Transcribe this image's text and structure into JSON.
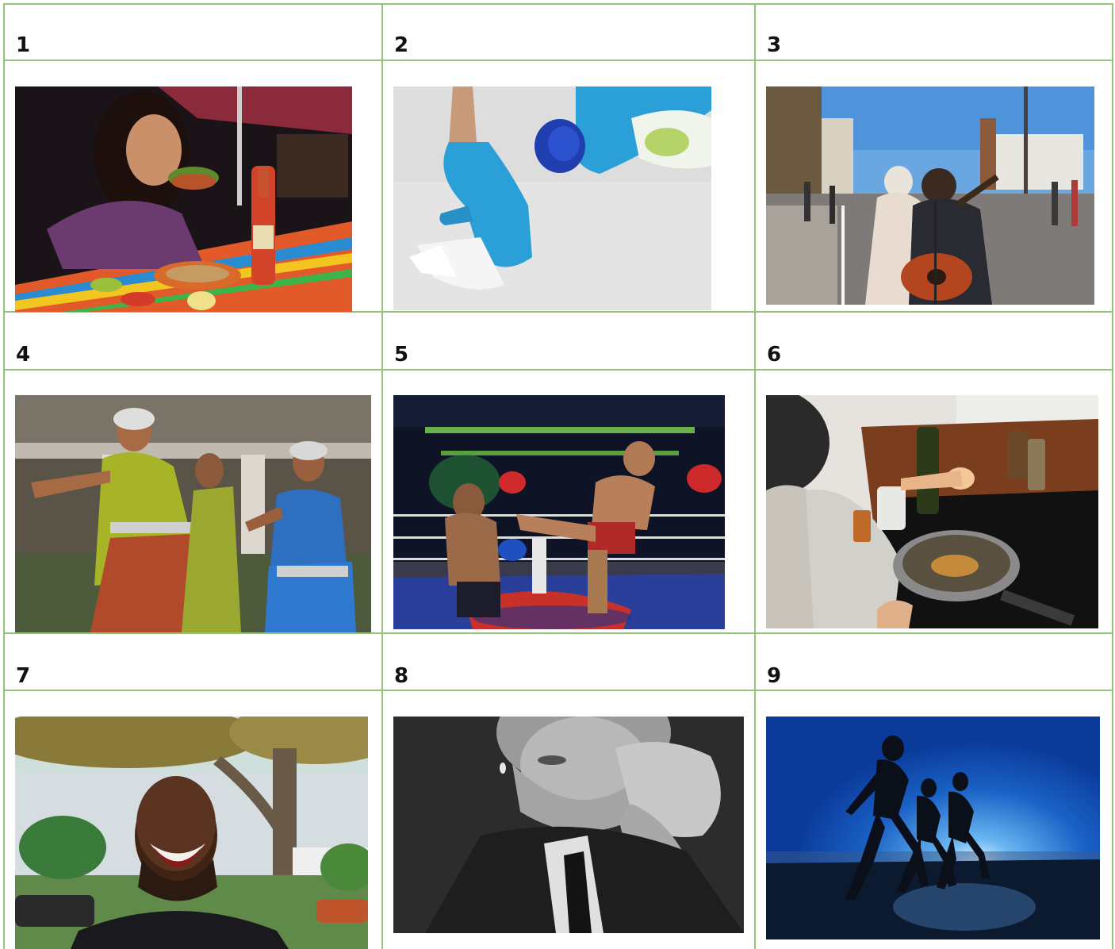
{
  "cells": [
    {
      "number": "1"
    },
    {
      "number": "2"
    },
    {
      "number": "3"
    },
    {
      "number": "4"
    },
    {
      "number": "5"
    },
    {
      "number": "6"
    },
    {
      "number": "7"
    },
    {
      "number": "8"
    },
    {
      "number": "9"
    }
  ],
  "colors": {
    "border": "#92c57a"
  }
}
